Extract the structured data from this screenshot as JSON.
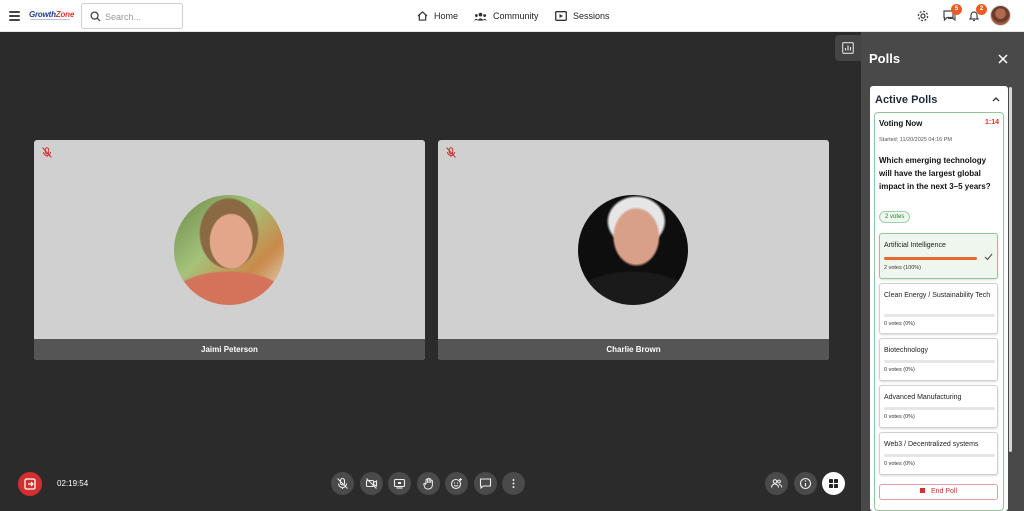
{
  "header": {
    "logo_main": "Growth",
    "logo_accent": "Zone",
    "search_placeholder": "Search...",
    "nav": [
      {
        "label": "Home",
        "icon": "home-icon"
      },
      {
        "label": "Community",
        "icon": "community-icon"
      },
      {
        "label": "Sessions",
        "icon": "sessions-icon"
      }
    ],
    "messages_badge": "5",
    "notifications_badge": "2"
  },
  "stage": {
    "participants": [
      {
        "name": "Jaimi Peterson",
        "muted": true
      },
      {
        "name": "Charlie Brown",
        "muted": true
      }
    ],
    "timer": "02:19:54"
  },
  "polls": {
    "title": "Polls",
    "section_title": "Active Polls",
    "poll": {
      "status": "Voting Now",
      "countdown": "1:14",
      "started": "Started: 11/20/2025 04:16 PM",
      "question": "Which emerging technology will have the largest global impact in the next 3–5 years?",
      "total_votes": "2 votes",
      "options": [
        {
          "label": "Artificial Intelligence",
          "votes": "2 votes (100%)",
          "percent": 100,
          "selected": true
        },
        {
          "label": "Clean Energy / Sustainability Tech",
          "votes": "0 votes (0%)",
          "percent": 0,
          "selected": false
        },
        {
          "label": "Biotechnology",
          "votes": "0 votes (0%)",
          "percent": 0,
          "selected": false
        },
        {
          "label": "Advanced Manufacturing",
          "votes": "0 votes (0%)",
          "percent": 0,
          "selected": false
        },
        {
          "label": "Web3 / Decentralized systems",
          "votes": "0 votes (0%)",
          "percent": 0,
          "selected": false
        }
      ],
      "end_label": "End Poll"
    }
  },
  "colors": {
    "accent": "#e8662f",
    "leave": "#d32f2f",
    "countdown": "#d93025",
    "selected_border": "#8fc69a"
  }
}
